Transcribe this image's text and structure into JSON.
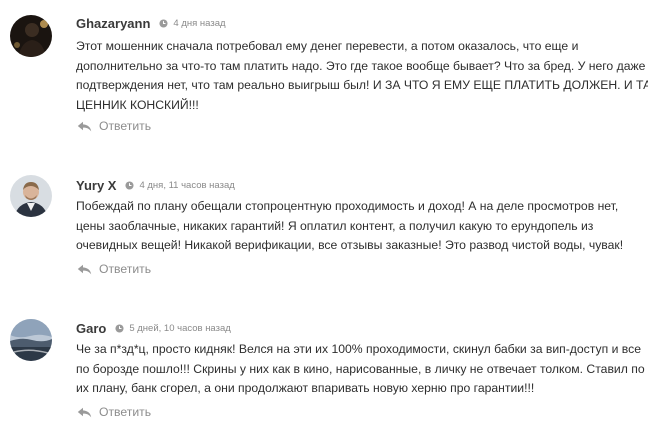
{
  "comments": [
    {
      "author": "Ghazaryann",
      "time": "4 дня назад",
      "lines": [
        "Этот мошенник сначала потребовал ему денег перевести, а потом оказалось, что еще и",
        "дополнительно за что-то там платить надо. Это где такое вообще бывает? Что за бред. У него даже",
        "подтверждения нет, что там реально выигрыш был! И ЗА ЧТО Я ЕМУ ЕЩЕ ПЛАТИТЬ ДОЛЖЕН. И ТАК",
        "ЦЕННИК КОНСКИЙ!!!"
      ],
      "reply_label": "Ответить"
    },
    {
      "author": "Yury X",
      "time": "4 дня, 11 часов назад",
      "lines": [
        "Побеждай по плану обещали стопроцентную проходимость и доход! А на деле просмотров нет,",
        "цены заоблачные, никаких гарантий! Я оплатил контент, а получил какую то ерундопель из",
        "очевидных вещей! Никакой верификации, все отзывы заказные! Это развод чистой воды, чувак!"
      ],
      "reply_label": "Ответить"
    },
    {
      "author": "Garo",
      "time": "5 дней, 10 часов назад",
      "lines": [
        "Че за п*зд*ц, просто кидняк! Велся на эти их 100% проходимости, скинул бабки за вип-доступ и все",
        "по борозде пошло!!! Скрины у них как в кино, нарисованные, в личку не отвечает толком. Ставил по",
        "их плану, банк сгорел, а они продолжают впаривать новую херню про гарантии!!!"
      ],
      "reply_label": "Ответить"
    }
  ],
  "icons": {
    "time": "clock-icon",
    "reply": "reply-arrow-icon"
  },
  "colors": {
    "author": "#3a3a3a",
    "text": "#2e2e2e",
    "muted": "#8a8a8a"
  }
}
